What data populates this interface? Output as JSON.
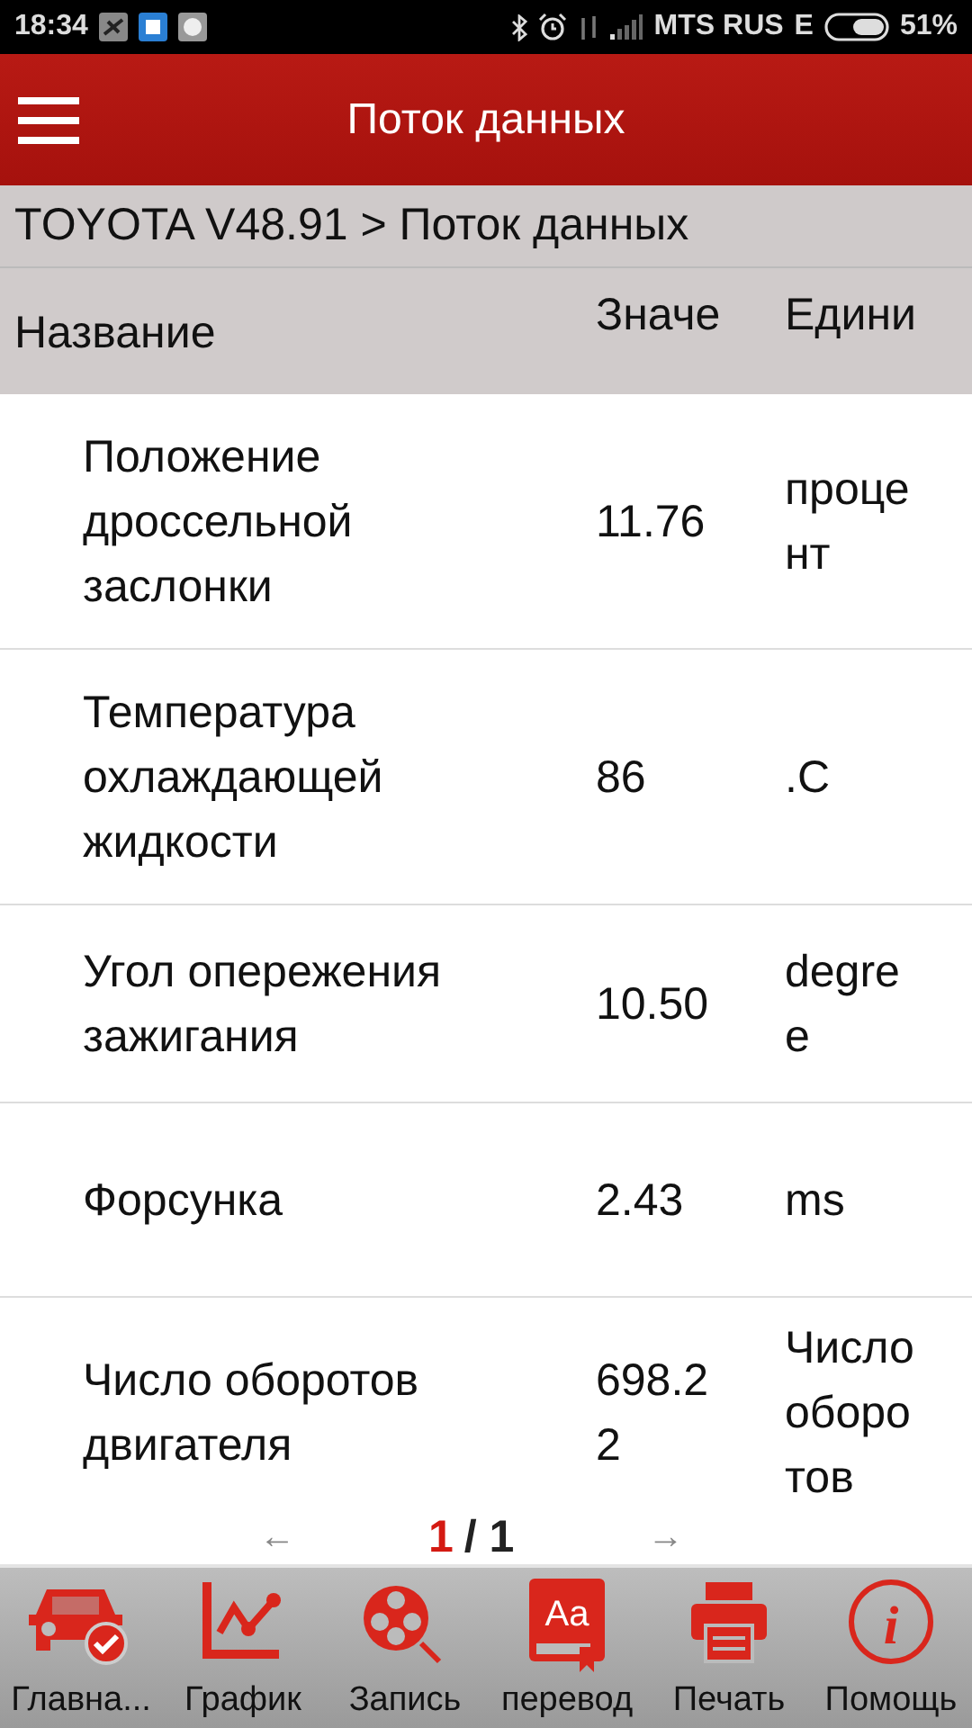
{
  "status_bar": {
    "time": "18:34",
    "carrier": "MTS RUS",
    "network": "E",
    "battery": "51%"
  },
  "app_bar": {
    "title": "Поток данных"
  },
  "breadcrumb": "TOYOTA V48.91 > Поток данных",
  "table": {
    "columns": [
      "Название",
      "Значе",
      "Едини"
    ],
    "rows": [
      {
        "name": "Положение дроссельной заслонки",
        "value": "11.76",
        "unit": "процент"
      },
      {
        "name": "Температура охлаждающей жидкости",
        "value": "86",
        "unit": ".C"
      },
      {
        "name": "Угол опережения зажигания",
        "value": "10.50",
        "unit": "degree"
      },
      {
        "name": "Форсунка",
        "value": "2.43",
        "unit": "ms"
      },
      {
        "name": "Число оборотов двигателя",
        "value": "698.22",
        "unit": "Число оборотов"
      }
    ]
  },
  "pager": {
    "prev": "←",
    "current": "1",
    "total": "/ 1",
    "next": "→"
  },
  "bottom_nav": [
    {
      "kind": "car",
      "label": "Главна..."
    },
    {
      "kind": "graph",
      "label": "График"
    },
    {
      "kind": "record",
      "label": "Запись"
    },
    {
      "kind": "translate",
      "label": "перевод",
      "icon_text": "Aa"
    },
    {
      "kind": "print",
      "label": "Печать"
    },
    {
      "kind": "help",
      "label": "Помощь",
      "icon_text": "i"
    }
  ]
}
